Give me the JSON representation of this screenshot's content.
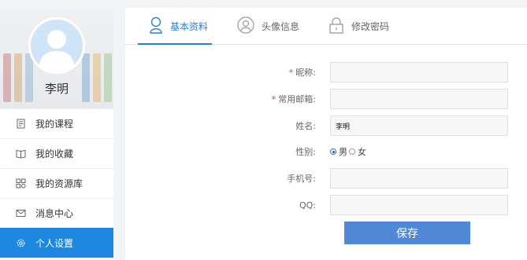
{
  "user": {
    "name": "李明"
  },
  "sidebar": {
    "items": [
      {
        "label": "我的课程",
        "icon": "document-icon"
      },
      {
        "label": "我的收藏",
        "icon": "book-icon"
      },
      {
        "label": "我的资源库",
        "icon": "grid-icon"
      },
      {
        "label": "消息中心",
        "icon": "envelope-icon"
      },
      {
        "label": "个人设置",
        "icon": "gear-icon",
        "active": true
      }
    ]
  },
  "tabs": [
    {
      "label": "基本资料",
      "icon": "user-icon",
      "active": true
    },
    {
      "label": "头像信息",
      "icon": "avatar-icon"
    },
    {
      "label": "修改密码",
      "icon": "lock-icon"
    }
  ],
  "form": {
    "nickname": {
      "label": "昵称:",
      "required_mark": "*",
      "value": ""
    },
    "email": {
      "label": "常用邮箱:",
      "required_mark": "*",
      "value": ""
    },
    "name": {
      "label": "姓名:",
      "value": "李明"
    },
    "gender": {
      "label": "性别:",
      "options": [
        "男",
        "女"
      ],
      "selected": "男"
    },
    "phone": {
      "label": "手机号:",
      "value": ""
    },
    "qq": {
      "label": "QQ:",
      "value": ""
    },
    "save_label": "保存"
  },
  "colors": {
    "accent": "#1e88e0",
    "tab_active": "#2d7fd6",
    "button": "#5088d6",
    "required": "#e03c3c"
  }
}
